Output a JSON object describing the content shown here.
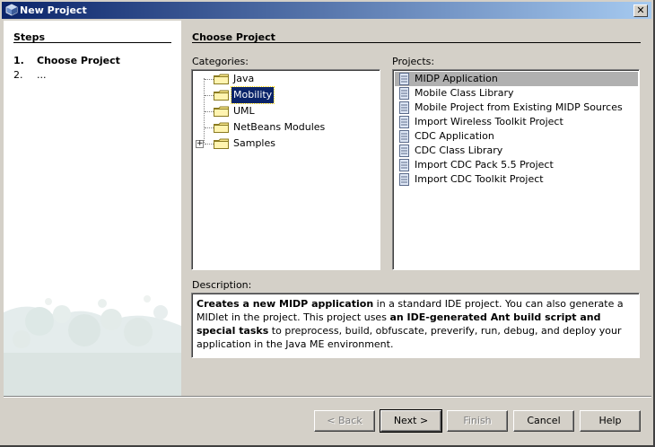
{
  "window": {
    "title": "New Project",
    "close_glyph": "✕"
  },
  "steps": {
    "title": "Steps",
    "items": [
      {
        "num": "1.",
        "label": "Choose Project"
      },
      {
        "num": "2.",
        "label": "..."
      }
    ]
  },
  "main": {
    "title": "Choose Project",
    "categories_label": "Categories:",
    "projects_label": "Projects:",
    "description_label": "Description:"
  },
  "categories": [
    {
      "label": "Java",
      "expandable": false,
      "selected": false
    },
    {
      "label": "Mobility",
      "expandable": false,
      "selected": true
    },
    {
      "label": "UML",
      "expandable": false,
      "selected": false
    },
    {
      "label": "NetBeans Modules",
      "expandable": false,
      "selected": false
    },
    {
      "label": "Samples",
      "expandable": true,
      "expander_glyph": "+",
      "selected": false
    }
  ],
  "projects": [
    {
      "label": "MIDP Application",
      "selected": true
    },
    {
      "label": "Mobile Class Library",
      "selected": false
    },
    {
      "label": "Mobile Project from Existing MIDP Sources",
      "selected": false
    },
    {
      "label": "Import Wireless Toolkit Project",
      "selected": false
    },
    {
      "label": "CDC Application",
      "selected": false
    },
    {
      "label": "CDC Class Library",
      "selected": false
    },
    {
      "label": "Import CDC Pack 5.5 Project",
      "selected": false
    },
    {
      "label": "Import CDC Toolkit Project",
      "selected": false
    }
  ],
  "description": {
    "part1_bold": "Creates a new MIDP application",
    "part2": " in a standard IDE project. You can also generate a MIDlet in the project. This project uses ",
    "part3_bold": "an IDE-generated Ant build script and special tasks",
    "part4": " to preprocess, build, obfuscate, preverify, run, debug, and deploy your application in the Java ME environment."
  },
  "buttons": {
    "back": "< Back",
    "next": "Next >",
    "finish": "Finish",
    "cancel": "Cancel",
    "help": "Help"
  },
  "colors": {
    "titlebar_start": "#0a246a",
    "titlebar_end": "#a6caf0",
    "selection": "#0a246a",
    "project_selection": "#b0b0b0",
    "dialog_bg": "#d4d0c8"
  }
}
